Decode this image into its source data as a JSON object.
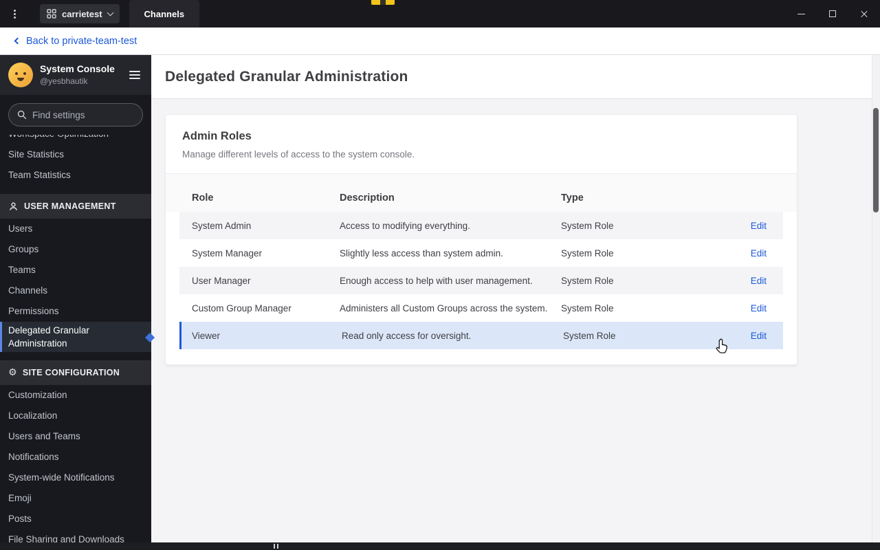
{
  "titlebar": {
    "server_name": "carrietest",
    "tab_label": "Channels"
  },
  "back_bar": {
    "label": "Back to private-team-test"
  },
  "sidebar": {
    "header": {
      "title": "System Console",
      "subtitle": "@yesbhautik"
    },
    "search": {
      "placeholder": "Find settings"
    },
    "groups": [
      {
        "items": [
          {
            "label": "Workspace Optimization"
          },
          {
            "label": "Site Statistics"
          },
          {
            "label": "Team Statistics"
          }
        ]
      },
      {
        "header": "USER MANAGEMENT",
        "items": [
          {
            "label": "Users"
          },
          {
            "label": "Groups"
          },
          {
            "label": "Teams"
          },
          {
            "label": "Channels"
          },
          {
            "label": "Permissions"
          },
          {
            "label": "Delegated Granular Administration",
            "active": true
          }
        ]
      },
      {
        "header": "SITE CONFIGURATION",
        "gear_glyph": "⚙",
        "items": [
          {
            "label": "Customization"
          },
          {
            "label": "Localization"
          },
          {
            "label": "Users and Teams"
          },
          {
            "label": "Notifications"
          },
          {
            "label": "System-wide Notifications"
          },
          {
            "label": "Emoji"
          },
          {
            "label": "Posts"
          },
          {
            "label": "File Sharing and Downloads"
          }
        ]
      }
    ]
  },
  "main": {
    "page_title": "Delegated Granular Administration",
    "card": {
      "title": "Admin Roles",
      "description": "Manage different levels of access to the system console.",
      "table": {
        "headers": {
          "role": "Role",
          "description": "Description",
          "type": "Type"
        },
        "edit_label": "Edit",
        "rows": [
          {
            "role": "System Admin",
            "description": "Access to modifying everything.",
            "type": "System Role"
          },
          {
            "role": "System Manager",
            "description": "Slightly less access than system admin.",
            "type": "System Role"
          },
          {
            "role": "User Manager",
            "description": "Enough access to help with user management.",
            "type": "System Role"
          },
          {
            "role": "Custom Group Manager",
            "description": "Administers all Custom Groups across the system.",
            "type": "System Role"
          },
          {
            "role": "Viewer",
            "description": "Read only access for oversight.",
            "type": "System Role",
            "highlighted": true
          }
        ]
      }
    }
  },
  "colors": {
    "accent_blue": "#1c58d9",
    "highlight_row": "#dbe7f8",
    "sidebar_bg": "#17191e",
    "titlebar_bg": "#19191d",
    "active_item_border": "#5d87e5"
  }
}
